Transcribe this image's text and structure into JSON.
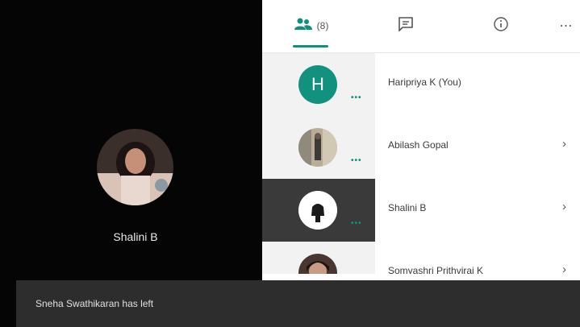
{
  "stage": {
    "name": "Shalini B"
  },
  "tabs": {
    "people_count": "(8)",
    "chat_icon": "chat-icon",
    "info_icon": "info-icon",
    "more_label": "⋯"
  },
  "participants": [
    {
      "name": "Haripriya K (You)",
      "avatar_letter": "H",
      "show_chevron": false
    },
    {
      "name": "Abilash Gopal",
      "avatar_letter": "",
      "show_chevron": true
    },
    {
      "name": "Shalini B",
      "avatar_letter": "",
      "show_chevron": true,
      "active": true
    },
    {
      "name": "Somyashri Prithviraj K",
      "avatar_letter": "",
      "show_chevron": true
    }
  ],
  "row_more_label": "•••",
  "chevron_label": "›",
  "toast": {
    "text": "Sneha Swathikaran has left"
  },
  "colors": {
    "accent": "#13917f",
    "stage_bg": "#050505",
    "toast_bg": "#2d2d2d"
  }
}
